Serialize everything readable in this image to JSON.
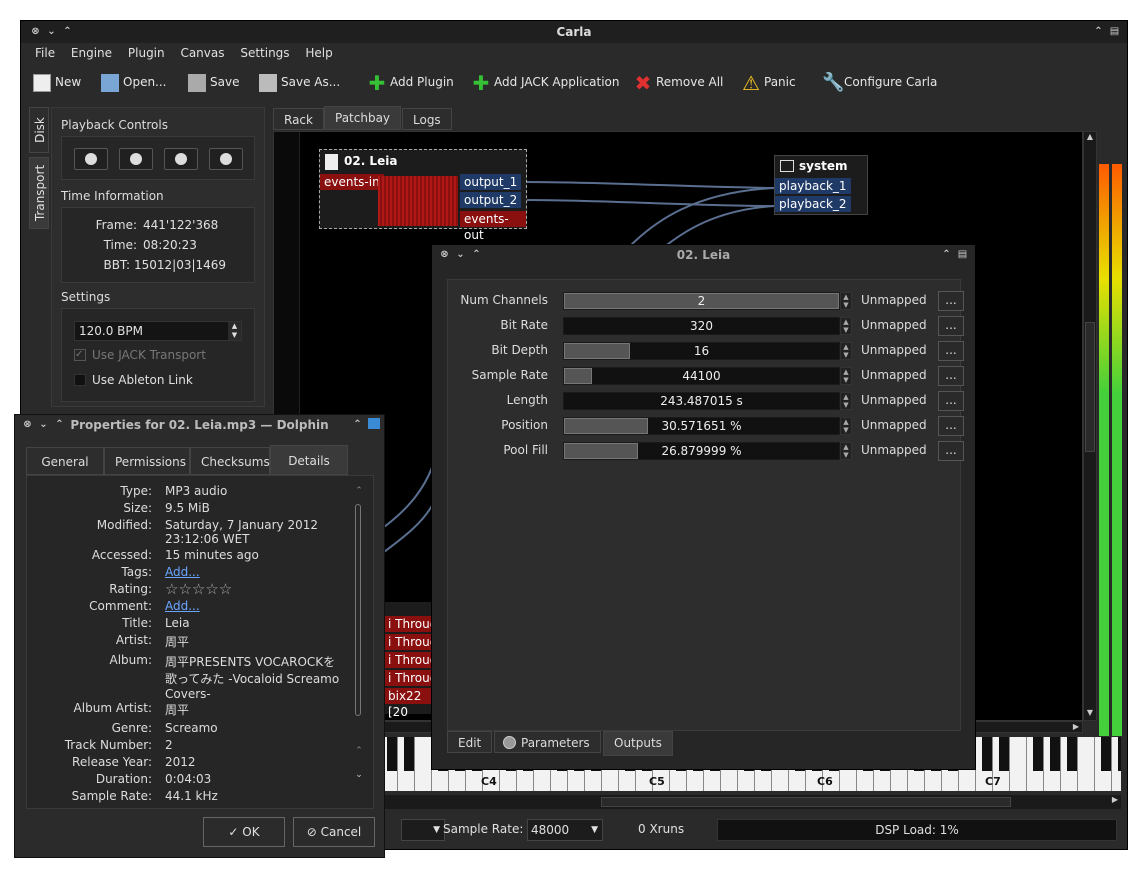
{
  "carla": {
    "title": "Carla",
    "menu": [
      "File",
      "Engine",
      "Plugin",
      "Canvas",
      "Settings",
      "Help"
    ],
    "toolbar": {
      "new": "New",
      "open": "Open...",
      "save": "Save",
      "save_as": "Save As...",
      "add_plugin": "Add Plugin",
      "add_jack": "Add JACK Application",
      "remove_all": "Remove All",
      "panic": "Panic",
      "configure": "Configure Carla"
    },
    "side_tabs": {
      "disk": "Disk",
      "transport": "Transport"
    },
    "transport": {
      "playback_title": "Playback Controls",
      "time_title": "Time Information",
      "frame_label": "Frame:",
      "frame": "441'122'368",
      "time_label": "Time:",
      "time": "08:20:23",
      "bbt_label": "BBT:",
      "bbt": "15012|03|1469",
      "settings_title": "Settings",
      "bpm": "120.0 BPM",
      "use_jack": "Use JACK Transport",
      "use_link": "Use Ableton Link"
    },
    "tabs": [
      "Rack",
      "Patchbay",
      "Logs"
    ],
    "patchbay": {
      "leia_title": "02. Leia",
      "events_in": "events-in",
      "output_1": "output_1",
      "output_2": "output_2",
      "events_out": "events-out",
      "system_title": "system",
      "playback_1": "playback_1",
      "playback_2": "playback_2",
      "midi": [
        "i Throug",
        "i Throug",
        "i Throug",
        "i Throug",
        "bix22 [20"
      ]
    },
    "piano": {
      "c4": "C4",
      "c5": "C5",
      "c6": "C6",
      "c7": "C7"
    },
    "status": {
      "sample_rate_label": "Sample Rate:",
      "sample_rate": "48000",
      "xruns": "0 Xruns",
      "dsp": "DSP Load: 1%"
    }
  },
  "plugin": {
    "title": "02. Leia",
    "params": [
      {
        "label": "Num Channels",
        "value": "2",
        "fill": 1.0,
        "mapping": "Unmapped"
      },
      {
        "label": "Bit Rate",
        "value": "320",
        "fill": 0.0,
        "mapping": "Unmapped"
      },
      {
        "label": "Bit Depth",
        "value": "16",
        "fill": 0.24,
        "mapping": "Unmapped"
      },
      {
        "label": "Sample Rate",
        "value": "44100",
        "fill": 0.1,
        "mapping": "Unmapped"
      },
      {
        "label": "Length",
        "value": "243.487015 s",
        "fill": 0.0,
        "mapping": "Unmapped"
      },
      {
        "label": "Position",
        "value": "30.571651 %",
        "fill": 0.30571651,
        "mapping": "Unmapped"
      },
      {
        "label": "Pool Fill",
        "value": "26.879999 %",
        "fill": 0.26879999,
        "mapping": "Unmapped"
      }
    ],
    "dots": "...",
    "tabs": [
      "Edit",
      "Parameters",
      "Outputs"
    ]
  },
  "dolphin": {
    "title": "Properties for 02. Leia.mp3 — Dolphin",
    "tabs": [
      "General",
      "Permissions",
      "Checksums",
      "Details"
    ],
    "rows": [
      {
        "label": "Type:",
        "value": "MP3 audio"
      },
      {
        "label": "Size:",
        "value": "9.5 MiB"
      },
      {
        "label": "Modified:",
        "value": "Saturday, 7 January 2012 23:12:06 WET"
      },
      {
        "label": "Accessed:",
        "value": "15 minutes ago"
      },
      {
        "label": "Tags:",
        "value": "Add..."
      },
      {
        "label": "Rating:",
        "value": "☆☆☆☆☆"
      },
      {
        "label": "Comment:",
        "value": "Add..."
      },
      {
        "label": "Title:",
        "value": "Leia"
      },
      {
        "label": "Artist:",
        "value": "周平"
      },
      {
        "label": "Album:",
        "value": "周平PRESENTS VOCAROCKを歌ってみた -Vocaloid Screamo Covers-"
      },
      {
        "label": "Album Artist:",
        "value": "周平"
      },
      {
        "label": "Genre:",
        "value": "Screamo"
      },
      {
        "label": "Track Number:",
        "value": "2"
      },
      {
        "label": "Release Year:",
        "value": "2012"
      },
      {
        "label": "Duration:",
        "value": "0:04:03"
      },
      {
        "label": "Sample Rate:",
        "value": "44.1 kHz"
      }
    ],
    "ok": "OK",
    "cancel": "Cancel"
  },
  "colors": {
    "accent": "#1f3a66",
    "red": "#8a1010",
    "meter_green": "#44d03a"
  }
}
